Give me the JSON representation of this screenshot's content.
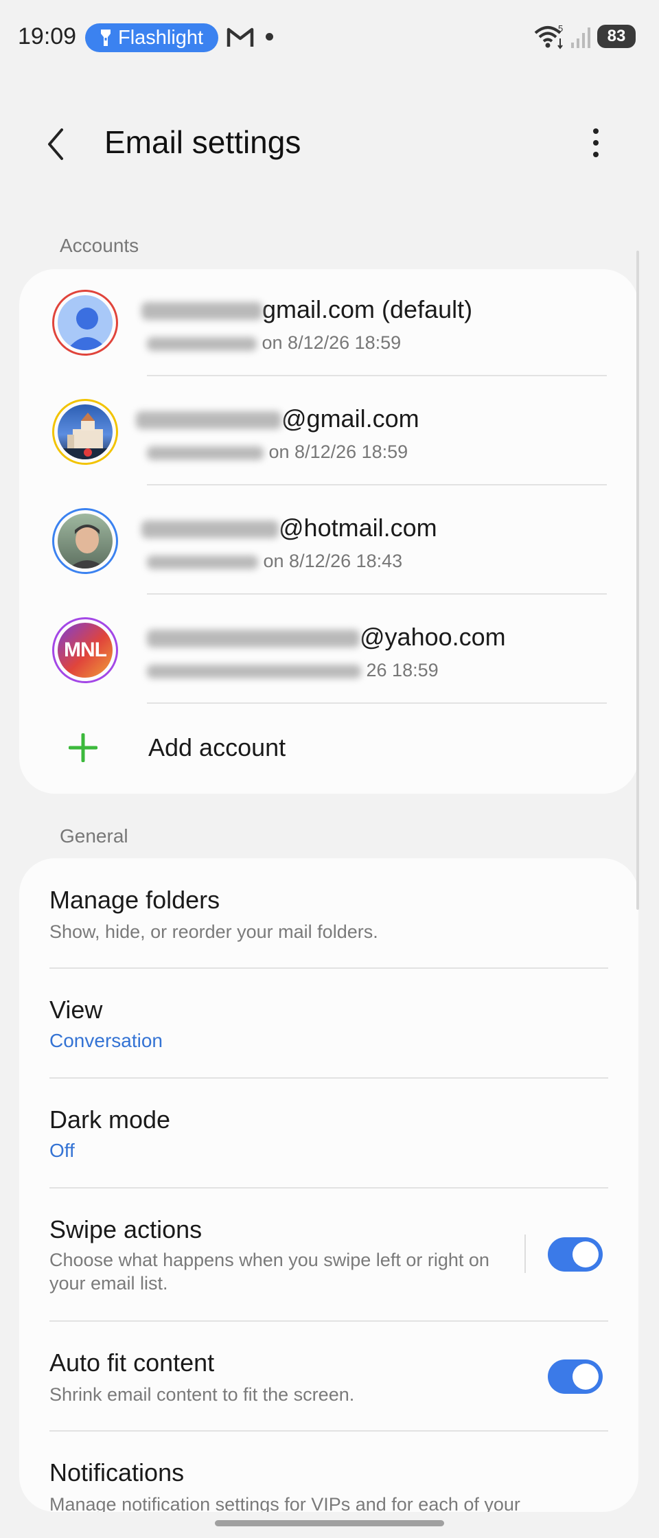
{
  "status_bar": {
    "time": "19:09",
    "flashlight_label": "Flashlight",
    "wifi_label": "5",
    "battery": "83"
  },
  "header": {
    "title": "Email settings"
  },
  "accounts_section": {
    "label": "Accounts",
    "accounts": [
      {
        "email_visible": "gmail.com (default)",
        "sync_visible": "on 8/12/26  18:59",
        "avatar": "default-person-avatar",
        "ring_color": "#e0443b"
      },
      {
        "email_visible": "@gmail.com",
        "sync_visible": "on 8/12/26  18:59",
        "avatar": "building-photo-avatar",
        "ring_color": "#f2c300"
      },
      {
        "email_visible": "@hotmail.com",
        "sync_visible": "on 8/12/26  18:43",
        "avatar": "person-photo-avatar",
        "ring_color": "#3b82f0"
      },
      {
        "email_visible": "@yahoo.com",
        "sync_visible": "26  18:59",
        "avatar": "mnl-logo-avatar",
        "ring_color": "#a347e6",
        "logo_text": "MNL"
      }
    ],
    "add_account_label": "Add account"
  },
  "general_section": {
    "label": "General",
    "items": [
      {
        "title": "Manage folders",
        "subtitle": "Show, hide, or reorder your mail folders."
      },
      {
        "title": "View",
        "value": "Conversation"
      },
      {
        "title": "Dark mode",
        "value": "Off"
      },
      {
        "title": "Swipe actions",
        "subtitle": "Choose what happens when you swipe left or right on your email list.",
        "toggle_on": true
      },
      {
        "title": "Auto fit content",
        "subtitle": "Shrink email content to fit the screen.",
        "toggle_on": true
      },
      {
        "title": "Notifications",
        "subtitle": "Manage notification settings for VIPs and for each of your"
      }
    ]
  },
  "colors": {
    "accent": "#3b7ae8",
    "value_text": "#3473d4",
    "add_icon": "#3cb93c",
    "background": "#f2f2f2",
    "card": "#fcfcfc"
  }
}
